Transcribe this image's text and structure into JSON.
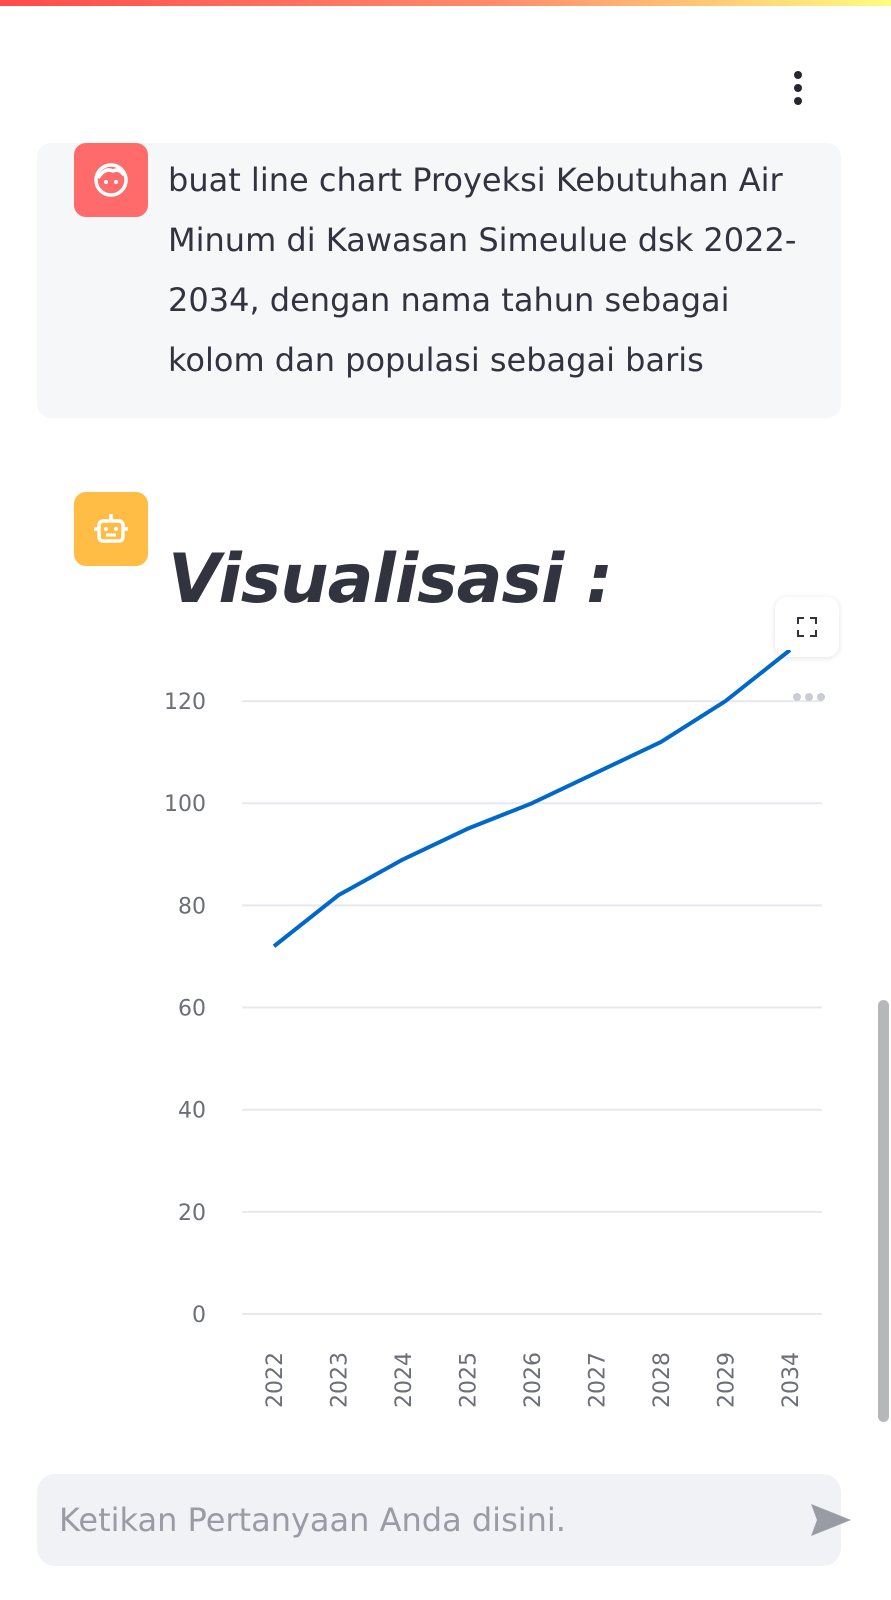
{
  "user_message": {
    "avatar_icon": "face-icon",
    "text": "buat line chart Proyeksi Kebutuhan Air Minum di Kawasan Simeulue dsk 2022-2034, dengan nama tahun sebagai kolom dan populasi sebagai baris"
  },
  "assistant_message": {
    "avatar_icon": "robot-icon",
    "title": "Visualisasi :"
  },
  "chart_data": {
    "type": "line",
    "categories": [
      "2022",
      "2023",
      "2024",
      "2025",
      "2026",
      "2027",
      "2028",
      "2029",
      "2034"
    ],
    "series": [
      {
        "values": [
          72,
          82,
          89,
          95,
          100,
          106,
          112,
          120,
          130
        ]
      }
    ],
    "ylim": [
      0,
      130
    ],
    "yticks": [
      0,
      20,
      40,
      60,
      80,
      100,
      120
    ],
    "grid": true,
    "line_color": "#0068c9"
  },
  "chat_input": {
    "placeholder": "Ketikan Pertanyaan Anda disini.",
    "send_icon": "send-icon"
  },
  "colors": {
    "accent": "#ff4b4b",
    "user_avatar": "#ff6b6b",
    "bot_avatar": "#ffbd45"
  }
}
